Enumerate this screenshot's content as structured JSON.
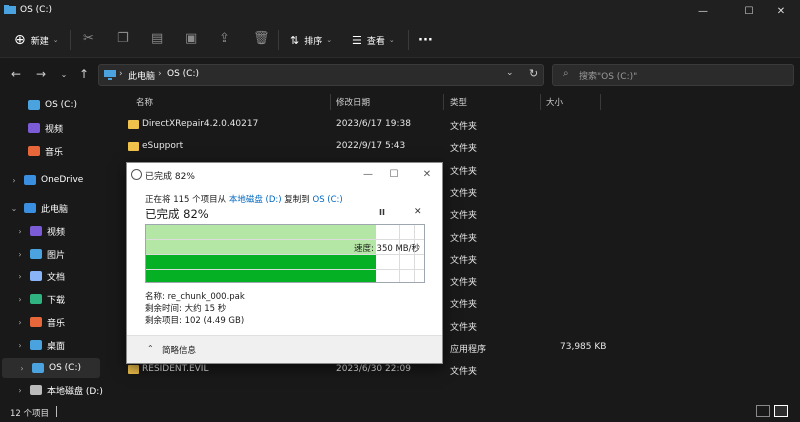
{
  "window": {
    "title": "OS (C:)",
    "controls": {
      "minimize": "—",
      "maximize": "☐",
      "close": "✕"
    }
  },
  "toolbar": {
    "new_label": "新建",
    "sort_label": "排序",
    "view_label": "查看",
    "more_label": "···"
  },
  "address": {
    "crumb1": "此电脑",
    "crumb2": "OS (C:)",
    "separator": "›",
    "search_placeholder": "搜索\"OS (C:)\""
  },
  "sidebar": {
    "items": [
      {
        "label": "OS (C:)",
        "icon": "drive-icon",
        "color": "#4aa3df"
      },
      {
        "label": "视频",
        "icon": "video-icon",
        "color": "#7b5cd6"
      },
      {
        "label": "音乐",
        "icon": "music-icon",
        "color": "#e8673a"
      },
      {
        "label": "OneDrive",
        "icon": "cloud-icon",
        "color": "#3b8fe0"
      },
      {
        "label": "此电脑",
        "icon": "computer-icon",
        "color": "#3b8fe0"
      },
      {
        "label": "视频",
        "icon": "video-icon",
        "color": "#7b5cd6"
      },
      {
        "label": "图片",
        "icon": "picture-icon",
        "color": "#4aa3df"
      },
      {
        "label": "文档",
        "icon": "document-icon",
        "color": "#8ab4f8"
      },
      {
        "label": "下载",
        "icon": "download-icon",
        "color": "#2fb380"
      },
      {
        "label": "音乐",
        "icon": "music-icon",
        "color": "#e8673a"
      },
      {
        "label": "桌面",
        "icon": "desktop-icon",
        "color": "#4aa3df"
      },
      {
        "label": "OS (C:)",
        "icon": "drive-icon",
        "color": "#4aa3df"
      },
      {
        "label": "本地磁盘 (D:)",
        "icon": "drive-icon",
        "color": "#bbbbbb"
      }
    ]
  },
  "columns": {
    "name": "名称",
    "date": "修改日期",
    "type": "类型",
    "size": "大小"
  },
  "files": [
    {
      "name": "DirectXRepair4.2.0.40217",
      "date": "2023/6/17 19:38",
      "type": "文件夹",
      "size": ""
    },
    {
      "name": "eSupport",
      "date": "2022/9/17 5:43",
      "type": "文件夹",
      "size": ""
    },
    {
      "name": "",
      "date": "",
      "type": "文件夹",
      "size": ""
    },
    {
      "name": "",
      "date": "",
      "type": "文件夹",
      "size": ""
    },
    {
      "name": "",
      "date": "",
      "type": "文件夹",
      "size": ""
    },
    {
      "name": "",
      "date": "",
      "type": "文件夹",
      "size": ""
    },
    {
      "name": "",
      "date": "",
      "type": "文件夹",
      "size": ""
    },
    {
      "name": "",
      "date": "",
      "type": "文件夹",
      "size": ""
    },
    {
      "name": "",
      "date": "",
      "type": "文件夹",
      "size": ""
    },
    {
      "name": "",
      "date": "",
      "type": "文件夹",
      "size": ""
    },
    {
      "name": "",
      "date": "",
      "type": "应用程序",
      "size": "73,985 KB"
    },
    {
      "name": "RESIDENT.EVIL",
      "date": "2023/6/30 22:09",
      "type": "文件夹",
      "size": ""
    }
  ],
  "status": {
    "item_count": "12 个项目"
  },
  "dialog": {
    "title": "已完成 82%",
    "copy_prefix": "正在将 115 个项目从",
    "source": "本地磁盘 (D:)",
    "copy_mid": "复制到",
    "destination": "OS (C:)",
    "heading": "已完成 82%",
    "progress_fraction": 0.82,
    "speed": "速度: 350 MB/秒",
    "name_line": "名称:  re_chunk_000.pak",
    "time_line": "剩余时间:  大约 15 秒",
    "items_line": "剩余项目:  102 (4.49 GB)",
    "details_label": "简略信息",
    "pause": "II",
    "cancel": "✕",
    "win_min": "—",
    "win_max": "☐",
    "win_close": "✕"
  }
}
